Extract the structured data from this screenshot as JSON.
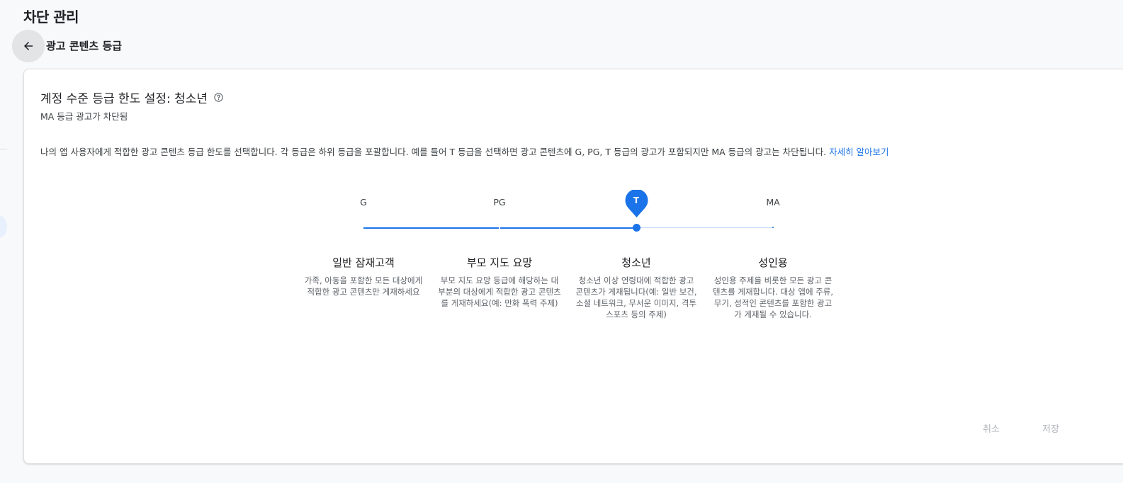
{
  "header": {
    "title": "차단 관리",
    "subpage_title": "광고 콘텐츠 등급"
  },
  "card": {
    "title": "계정 수준 등급 한도 설정: 청소년",
    "subtitle": "MA 등급 광고가 차단됨",
    "description": "나의 앱 사용자에게 적합한 광고 콘텐츠 등급 한도를 선택합니다. 각 등급은 하위 등급을 포괄합니다. 예를 들어 T 등급을 선택하면 광고 콘텐츠에 G, PG, T 등급의 광고가 포함되지만 MA 등급의 광고는 차단됩니다.",
    "learn_more": "자세히 알아보기"
  },
  "slider": {
    "ticks": [
      "G",
      "PG",
      "T",
      "MA"
    ],
    "selected_index": 2,
    "selected_label": "T"
  },
  "ratings": [
    {
      "name": "일반 잠재고객",
      "desc": "가족, 아동을 포함한 모든 대상에게 적합한 광고 콘텐츠만 게재하세요"
    },
    {
      "name": "부모 지도 요망",
      "desc": "부모 지도 요망 등급에 해당하는 대부분의 대상에게 적합한 광고 콘텐츠를 게재하세요(예: 만화 폭력 주제)"
    },
    {
      "name": "청소년",
      "desc": "청소년 이상 연령대에 적합한 광고 콘텐츠가 게재됩니다(예: 일반 보건, 소셜 네트워크, 무서운 이미지, 격투 스포츠 등의 주제)"
    },
    {
      "name": "성인용",
      "desc": "성인용 주제를 비롯한 모든 광고 콘텐츠를 게재합니다. 대상 앱에 주류, 무기, 성적인 콘텐츠를 포함한 광고가 게재될 수 있습니다."
    }
  ],
  "footer": {
    "cancel_label": "취소",
    "save_label": "저장"
  },
  "colors": {
    "accent": "#1a73e8",
    "track_inactive": "#c6dafc",
    "disabled_text": "#b0b3b8"
  }
}
